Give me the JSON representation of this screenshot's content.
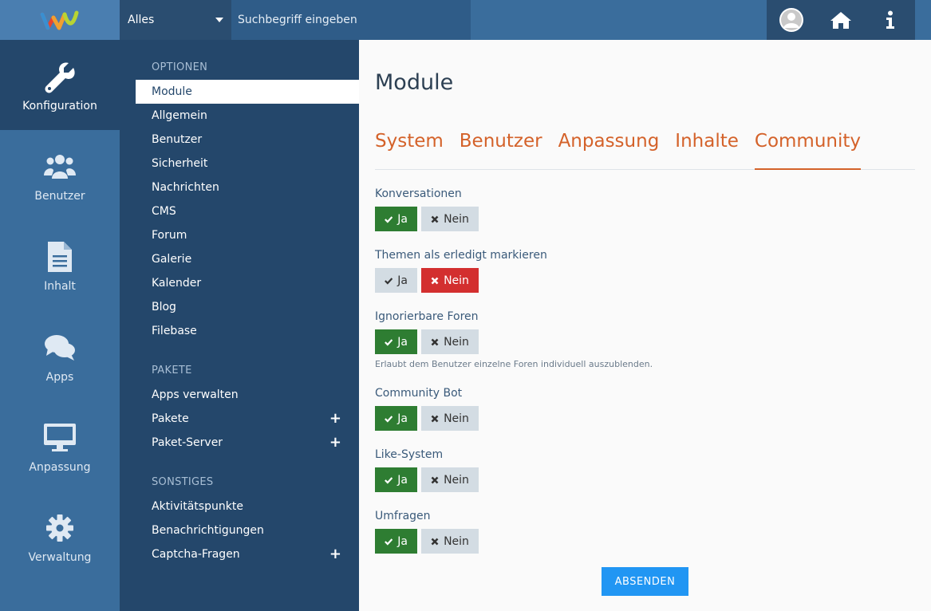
{
  "header": {
    "search_scope": "Alles",
    "search_placeholder": "Suchbegriff eingeben"
  },
  "main_nav": [
    {
      "label": "Konfiguration",
      "icon": "wrench-icon",
      "active": true
    },
    {
      "label": "Benutzer",
      "icon": "users-icon",
      "active": false
    },
    {
      "label": "Inhalt",
      "icon": "document-icon",
      "active": false
    },
    {
      "label": "Apps",
      "icon": "chat-icon",
      "active": false
    },
    {
      "label": "Anpassung",
      "icon": "monitor-icon",
      "active": false
    },
    {
      "label": "Verwaltung",
      "icon": "gear-icon",
      "active": false
    }
  ],
  "sub_nav": {
    "optionen_heading": "OPTIONEN",
    "optionen": [
      "Module",
      "Allgemein",
      "Benutzer",
      "Sicherheit",
      "Nachrichten",
      "CMS",
      "Forum",
      "Galerie",
      "Kalender",
      "Blog",
      "Filebase"
    ],
    "pakete_heading": "PAKETE",
    "pakete": [
      "Apps verwalten",
      "Pakete",
      "Paket-Server"
    ],
    "sonstiges_heading": "SONSTIGES",
    "sonstiges": [
      "Aktivitätspunkte",
      "Benachrichtigungen",
      "Captcha-Fragen"
    ]
  },
  "content": {
    "title": "Module",
    "tabs": [
      "System",
      "Benutzer",
      "Anpassung",
      "Inhalte",
      "Community"
    ],
    "active_tab": "Community",
    "yes_label": "Ja",
    "no_label": "Nein",
    "options": [
      {
        "label": "Konversationen",
        "value": "Ja"
      },
      {
        "label": "Themen als erledigt markieren",
        "value": "Nein"
      },
      {
        "label": "Ignorierbare Foren",
        "value": "Ja",
        "description": "Erlaubt dem Benutzer einzelne Foren individuell auszublenden."
      },
      {
        "label": "Community Bot",
        "value": "Ja"
      },
      {
        "label": "Like-System",
        "value": "Ja"
      },
      {
        "label": "Umfragen",
        "value": "Ja"
      }
    ],
    "submit_label": "ABSENDEN"
  },
  "colors": {
    "accent": "#d4622a",
    "yes_active": "#2e7d32",
    "no_active": "#d32f2f",
    "submit": "#2196f3"
  }
}
